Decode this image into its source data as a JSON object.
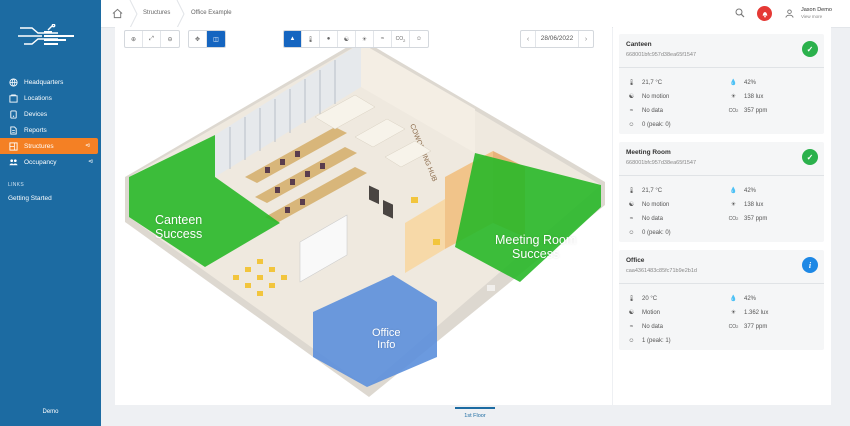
{
  "sidebar": {
    "items": [
      {
        "label": "Headquarters",
        "icon": "globe-icon"
      },
      {
        "label": "Locations",
        "icon": "location-icon"
      },
      {
        "label": "Devices",
        "icon": "device-icon"
      },
      {
        "label": "Reports",
        "icon": "report-icon"
      },
      {
        "label": "Structures",
        "icon": "structure-icon",
        "active": true
      },
      {
        "label": "Occupancy",
        "icon": "people-icon"
      }
    ],
    "links_heading": "LINKS",
    "link_getting_started": "Getting Started",
    "footer": "Demo",
    "accent": "#f48024",
    "bg": "#1c6ba2"
  },
  "topbar": {
    "breadcrumb": [
      "Structures",
      "Office Example"
    ],
    "user_name": "Jason Demo",
    "user_sub": "View more"
  },
  "toolbar": {
    "date": "28/06/2022"
  },
  "plan": {
    "rooms": {
      "canteen": {
        "line1": "Canteen",
        "line2": "Success",
        "color": "#28b828"
      },
      "meeting": {
        "line1": "Meeting Room",
        "line2": "Success",
        "color": "#28b828"
      },
      "office": {
        "line1": "Office",
        "line2": "Info",
        "color": "#5b8fdc"
      }
    },
    "wall_text": "COWORKING HUB"
  },
  "floor_tab": "1st Floor",
  "rooms": [
    {
      "name": "Canteen",
      "id": "668001bfc957d38ea65f1547",
      "status": "success",
      "temp": "21,7 °C",
      "humidity": "42%",
      "motion": "No motion",
      "light": "138 lux",
      "extra": "No data",
      "co2": "357 ppm",
      "occupancy": "0 (peak: 0)"
    },
    {
      "name": "Meeting Room",
      "id": "668001bfc957d38ea65f1547",
      "status": "success",
      "temp": "21,7 °C",
      "humidity": "42%",
      "motion": "No motion",
      "light": "138 lux",
      "extra": "No data",
      "co2": "357 ppm",
      "occupancy": "0 (peak: 0)"
    },
    {
      "name": "Office",
      "id": "caa4361483c85fc71b9e2b1d",
      "status": "info",
      "temp": "20 °C",
      "humidity": "42%",
      "motion": "Motion",
      "light": "1.362 lux",
      "extra": "No data",
      "co2": "377 ppm",
      "occupancy": "1 (peak: 1)"
    }
  ],
  "co2_label": "CO",
  "co2_sub": "2"
}
